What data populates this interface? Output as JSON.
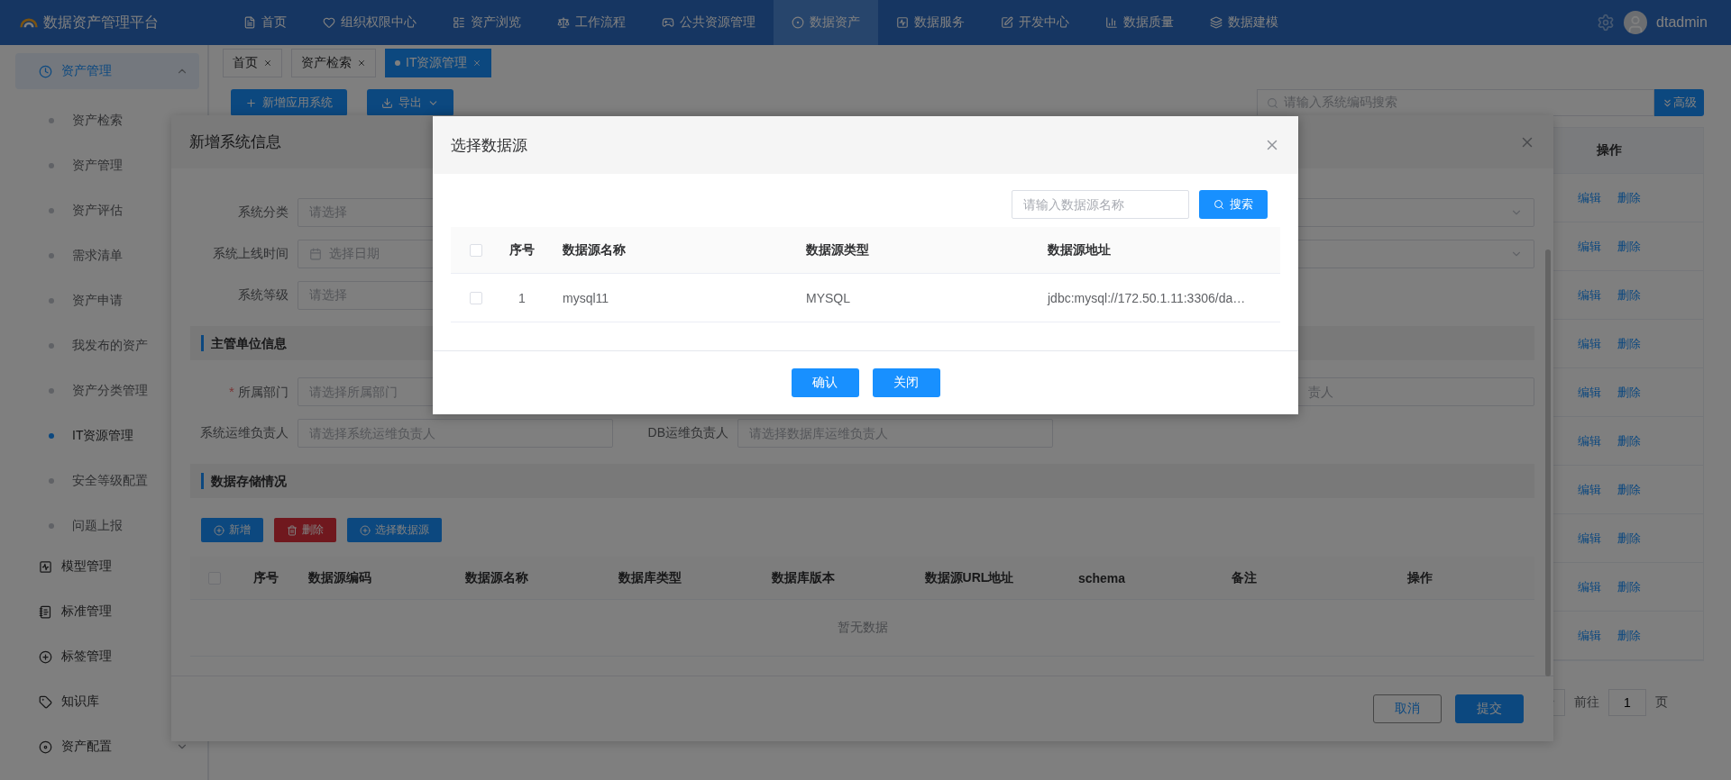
{
  "top_nav": {
    "logo_text": "数据资产管理平台",
    "user": "dtadmin",
    "items": [
      {
        "label": "首页",
        "selected": false
      },
      {
        "label": "组织权限中心",
        "selected": false
      },
      {
        "label": "资产浏览",
        "selected": false
      },
      {
        "label": "工作流程",
        "selected": false
      },
      {
        "label": "公共资源管理",
        "selected": false
      },
      {
        "label": "数据资产",
        "selected": true
      },
      {
        "label": "数据服务",
        "selected": false
      },
      {
        "label": "开发中心",
        "selected": false
      },
      {
        "label": "数据质量",
        "selected": false
      },
      {
        "label": "数据建模",
        "selected": false
      }
    ]
  },
  "sidebar": {
    "items": [
      {
        "label": "资产管理",
        "kind": "group",
        "selected": true,
        "expanded": true,
        "children": [
          {
            "label": "资产检索",
            "selected": false
          },
          {
            "label": "资产管理",
            "selected": false
          },
          {
            "label": "资产评估",
            "selected": false
          },
          {
            "label": "需求清单",
            "selected": false
          },
          {
            "label": "资产申请",
            "selected": false
          },
          {
            "label": "我发布的资产",
            "selected": false
          },
          {
            "label": "资产分类管理",
            "selected": false
          },
          {
            "label": "IT资源管理",
            "selected": true
          },
          {
            "label": "安全等级配置",
            "selected": false
          },
          {
            "label": "问题上报",
            "selected": false
          }
        ]
      },
      {
        "label": "模型管理",
        "kind": "link",
        "selected": false
      },
      {
        "label": "标准管理",
        "kind": "link",
        "selected": false
      },
      {
        "label": "标签管理",
        "kind": "link",
        "selected": false
      },
      {
        "label": "知识库",
        "kind": "link",
        "selected": false
      },
      {
        "label": "资产配置",
        "kind": "group",
        "selected": false,
        "expanded": false
      }
    ]
  },
  "tabs": [
    {
      "label": "首页",
      "selected": false
    },
    {
      "label": "资产检索",
      "selected": false
    },
    {
      "label": "IT资源管理",
      "selected": true
    }
  ],
  "toolbar": {
    "add_button": "新增应用系统",
    "export_button": "导出",
    "search": {
      "placeholder": "请输入系统编码搜索"
    },
    "advanced_button": "高级"
  },
  "table": {
    "action_column": "操作",
    "rows": [
      {
        "actions": [
          "编辑",
          "删除"
        ]
      },
      {
        "actions": [
          "编辑",
          "删除"
        ]
      },
      {
        "actions": [
          "编辑",
          "删除"
        ]
      },
      {
        "actions": [
          "编辑",
          "删除"
        ]
      },
      {
        "actions": [
          "编辑",
          "删除"
        ]
      },
      {
        "actions": [
          "编辑",
          "删除"
        ]
      },
      {
        "actions": [
          "编辑",
          "删除"
        ]
      },
      {
        "actions": [
          "编辑",
          "删除"
        ]
      },
      {
        "actions": [
          "编辑",
          "删除"
        ]
      },
      {
        "actions": [
          "编辑",
          "删除"
        ]
      }
    ]
  },
  "pagination": {
    "goto_label": "前往",
    "page": "1",
    "page_suffix": "页"
  },
  "form_dialog": {
    "title": "新增系统信息",
    "basic_fields": [
      {
        "label": "系统分类",
        "placeholder": "请选择",
        "kind": "select"
      },
      {
        "label": "系统上线时间",
        "placeholder": "选择日期",
        "kind": "date"
      },
      {
        "label": "系统等级",
        "placeholder": "请选择",
        "kind": "select"
      }
    ],
    "basic_right_fields": [
      {
        "kind": "select"
      },
      {
        "kind": "select"
      }
    ],
    "owner_section": {
      "title": "主管单位信息",
      "required_mark": "*",
      "fields": [
        {
          "label": "所属部门",
          "required": true,
          "placeholder": "请选择所属部门"
        },
        {
          "label": "系统运维负责人",
          "required": false,
          "placeholder": "请选择系统运维负责人"
        },
        {
          "label": "DB运维负责人",
          "required": false,
          "placeholder": "请选择数据库运维负责人"
        }
      ],
      "partial_field": {
        "placeholder": "责人"
      }
    },
    "storage_section": {
      "title": "数据存储情况",
      "buttons": [
        {
          "label": "新增",
          "kind": "add"
        },
        {
          "label": "删除",
          "kind": "delete"
        },
        {
          "label": "选择数据源",
          "kind": "add"
        }
      ],
      "header_checked": false,
      "columns": [
        "序号",
        "数据源编码",
        "数据源名称",
        "数据库类型",
        "数据库版本",
        "数据源URL地址",
        "schema",
        "备注",
        "操作"
      ],
      "empty_text": "暂无数据"
    },
    "footer_buttons": [
      {
        "label": "取消",
        "kind": "secondary"
      },
      {
        "label": "提交",
        "kind": "primary"
      }
    ]
  },
  "select_dialog": {
    "title": "选择数据源",
    "search": {
      "placeholder": "请输入数据源名称"
    },
    "search_button": "搜索",
    "header_checked": false,
    "columns": [
      "序号",
      "数据源名称",
      "数据源类型",
      "数据源地址"
    ],
    "rows": [
      {
        "checked": false,
        "cells": [
          "1",
          "mysql11",
          "MYSQL",
          "jdbc:mysql://172.50.1.11:3306/da…"
        ]
      }
    ],
    "buttons": [
      "确认",
      "关闭"
    ]
  }
}
